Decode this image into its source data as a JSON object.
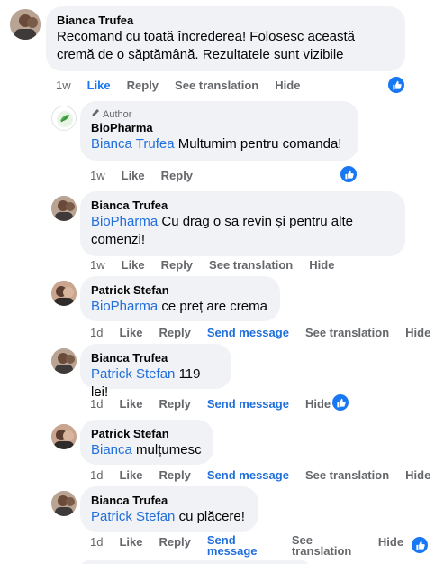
{
  "comments": [
    {
      "name": "Bianca Trufea",
      "mention": "",
      "text": "Recomand cu toată încrederea! Folosesc această cremă de o săptămână. Rezultatele sunt vizibile",
      "time": "1w",
      "actions": [
        "Like",
        "Reply",
        "See translation",
        "Hide"
      ]
    },
    {
      "author_label": "Author",
      "name": "BioPharma",
      "mention": "Bianca Trufea",
      "text": "Multumim pentru comanda!",
      "time": "1w",
      "actions": [
        "Like",
        "Reply"
      ]
    },
    {
      "name": "Bianca Trufea",
      "mention": "BioPharma",
      "text": "Cu drag o sa revin și pentru alte comenzi!",
      "time": "1w",
      "actions": [
        "Like",
        "Reply",
        "See translation",
        "Hide"
      ]
    },
    {
      "name": "Patrick Stefan",
      "mention": "BioPharma",
      "text": "ce preț are crema",
      "time": "1d",
      "actions": [
        "Like",
        "Reply",
        "Send message",
        "See translation",
        "Hide"
      ]
    },
    {
      "name": "Bianca Trufea",
      "mention": "Patrick Stefan",
      "text": "119 lei!",
      "time": "1d",
      "actions": [
        "Like",
        "Reply",
        "Send message",
        "Hide"
      ]
    },
    {
      "name": "Patrick Stefan",
      "mention": "Bianca",
      "text": "mulțumesc",
      "time": "1d",
      "actions": [
        "Like",
        "Reply",
        "Send message",
        "See translation",
        "Hide"
      ]
    },
    {
      "name": "Bianca Trufea",
      "mention": "Patrick Stefan",
      "text": "cu plăcere!",
      "time": "1d",
      "actions": [
        "Like",
        "Reply",
        "Send message",
        "See translation",
        "Hide"
      ]
    }
  ],
  "colors": {
    "bubble": "#f0f2f5",
    "mention": "#216fdb",
    "like_badge": "#1877f2",
    "meta": "#65676b"
  }
}
